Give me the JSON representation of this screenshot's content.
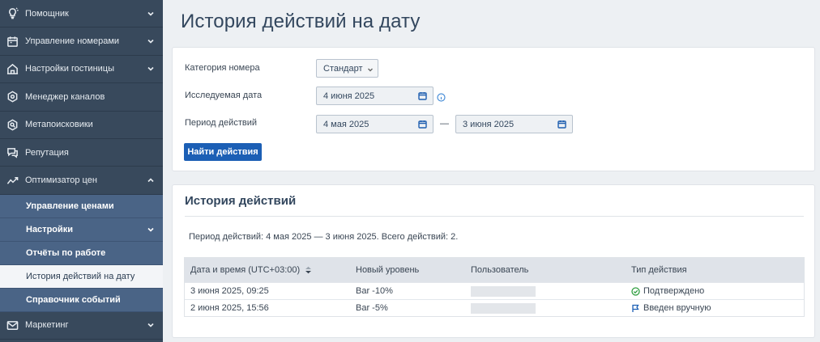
{
  "sidebar": {
    "items": [
      {
        "label": "Помощник",
        "icon": "lightbulb-icon"
      },
      {
        "label": "Управление номерами",
        "icon": "calendar-icon"
      },
      {
        "label": "Настройки гостиницы",
        "icon": "building-icon"
      },
      {
        "label": "Менеджер каналов",
        "icon": "hexagon-network-icon"
      },
      {
        "label": "Метапоисковики",
        "icon": "hexagon-search-icon"
      },
      {
        "label": "Репутация",
        "icon": "chat-icon"
      },
      {
        "label": "Оптимизатор цен",
        "icon": "trend-icon"
      }
    ],
    "sub_items": [
      {
        "label": "Управление ценами"
      },
      {
        "label": "Настройки"
      },
      {
        "label": "Отчёты по работе"
      },
      {
        "label": "История действий на дату"
      },
      {
        "label": "Справочник событий"
      }
    ],
    "bottom_item": {
      "label": "Маркетинг",
      "icon": "mail-icon"
    }
  },
  "page": {
    "title": "История действий на дату"
  },
  "filters": {
    "category_label": "Категория номера",
    "category_value": "Стандарт",
    "date_label": "Исследуемая дата",
    "date_value": "4 июня 2025",
    "period_label": "Период действий",
    "period_from": "4 мая 2025",
    "period_separator": "—",
    "period_to": "3 июня 2025",
    "search_button": "Найти действия"
  },
  "history": {
    "title": "История действий",
    "summary": "Период действий: 4 мая 2025 — 3 июня 2025. Всего действий: 2.",
    "columns": [
      "Дата и время (UTC+03:00)",
      "Новый уровень",
      "Пользователь",
      "Тип действия"
    ],
    "rows": [
      {
        "datetime": "3 июня 2025, 09:25",
        "level": "Bar -10%",
        "user": "",
        "type": "Подтверждено",
        "type_icon": "check-circle-icon"
      },
      {
        "datetime": "2 июня 2025, 15:56",
        "level": "Bar -5%",
        "user": "",
        "type": "Введен вручную",
        "type_icon": "flag-icon"
      }
    ]
  },
  "colors": {
    "sidebar_bg": "#38495c",
    "submenu_bg": "#4a6486",
    "primary": "#1c5fb5",
    "confirmed": "#2e9d3f"
  }
}
